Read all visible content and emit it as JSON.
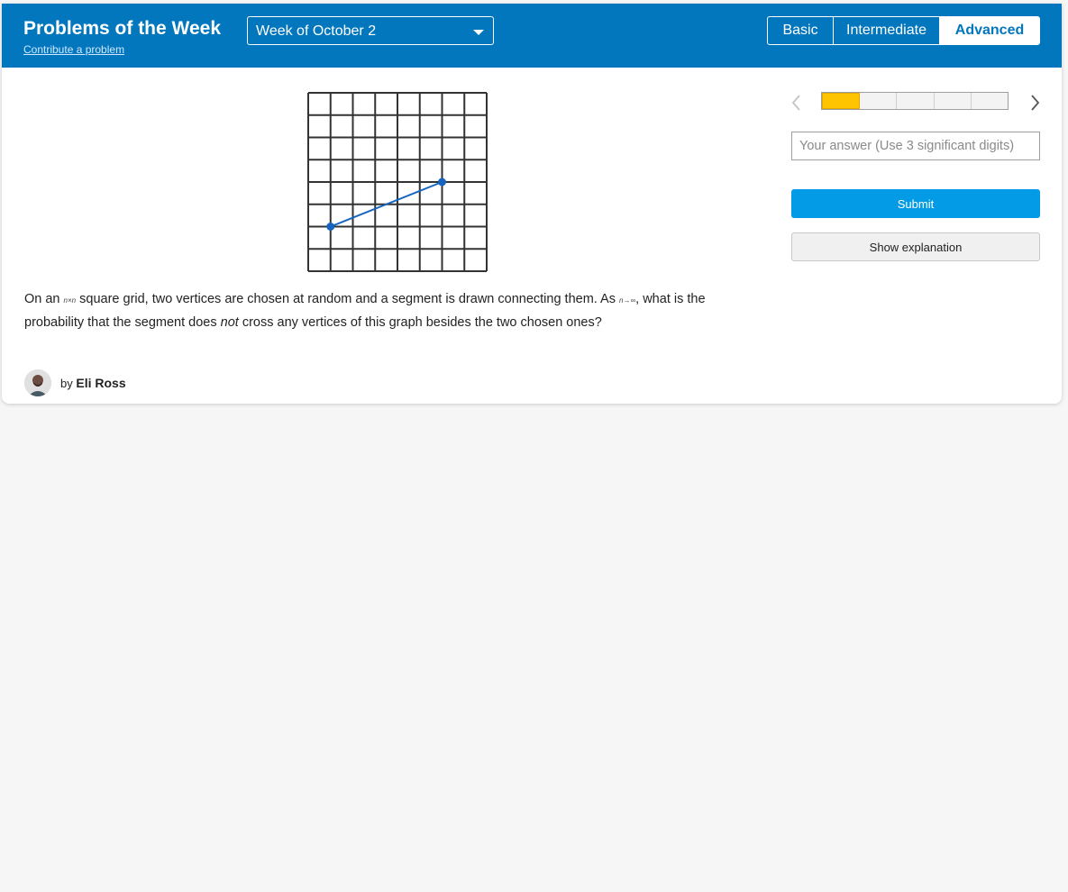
{
  "header": {
    "title": "Problems of the Week",
    "contribute_link": "Contribute a problem",
    "week_select": {
      "selected": "Week of October 2"
    },
    "levels": [
      {
        "label": "Basic",
        "active": false
      },
      {
        "label": "Intermediate",
        "active": false
      },
      {
        "label": "Advanced",
        "active": true
      }
    ],
    "brand_color": "#0277bd"
  },
  "figure": {
    "grid_lines": 9,
    "segment": {
      "from": [
        1,
        2
      ],
      "to": [
        6,
        4
      ]
    },
    "segment_color": "#1565c0"
  },
  "problem": {
    "text_1": "On an ",
    "math_1": "n×n",
    "text_2": " square grid, two vertices are chosen at random and a segment is drawn connecting them. As ",
    "math_2": "n→∞",
    "text_3": ", what is the probability that the segment does ",
    "emphasis": "not",
    "text_4": " cross any vertices of this graph besides the two chosen ones?"
  },
  "author": {
    "prefix": "by",
    "name": "Eli Ross",
    "avatar_icon": "user-avatar"
  },
  "sidebar": {
    "progress": {
      "total": 5,
      "current": 1,
      "highlight_color": "#ffc400"
    },
    "prev_icon": "chevron-left-icon",
    "next_icon": "chevron-right-icon",
    "answer_placeholder": "Your answer (Use 3 significant digits)",
    "submit_label": "Submit",
    "explanation_label": "Show explanation",
    "submit_color": "#039be5"
  }
}
